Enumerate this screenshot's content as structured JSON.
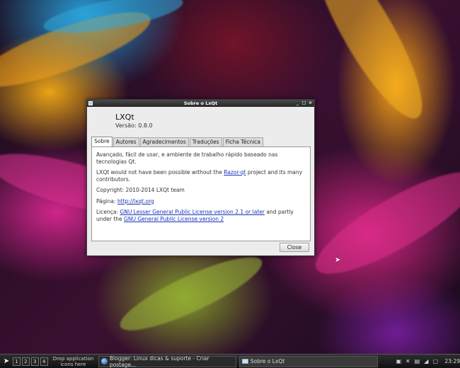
{
  "window": {
    "title": "Sobre o LxQt",
    "buttons": [
      "_",
      "□",
      "×"
    ]
  },
  "header": {
    "app_name": "LXQt",
    "version": "Versão: 0.8.0"
  },
  "tabs": [
    {
      "label": "Sobre",
      "active": true
    },
    {
      "label": "Autores",
      "active": false
    },
    {
      "label": "Agradecimentos",
      "active": false
    },
    {
      "label": "Traduções",
      "active": false
    },
    {
      "label": "Ficha Técnica",
      "active": false
    }
  ],
  "about": {
    "description": "Avançado, fácil de usar, e ambiente de trabalho rápido baseado nas tecnologias Qt.",
    "razor_prefix": "LXQt would not have been possible without the ",
    "razor_link": "Razor-qt",
    "razor_suffix": " project and its many contributors.",
    "copyright": "Copyright: 2010-2014 LXQt team",
    "page_label": "Página: ",
    "page_link": "http://lxqt.org",
    "license_label": "Licença: ",
    "license_link1": "GNU Lesser General Public License version 2.1 or later",
    "license_mid": " and partly under the ",
    "license_link2": "GNU General Public License version 2"
  },
  "close_label": "Close",
  "taskbar": {
    "desktops": [
      "1",
      "2",
      "3",
      "4"
    ],
    "drop_text": "Drop application icons here",
    "tasks": [
      {
        "label": "Blogger: Linux dicas & suporte - Criar postage..."
      },
      {
        "label": "Sobre o LxQt"
      }
    ],
    "clock": "23:29"
  }
}
